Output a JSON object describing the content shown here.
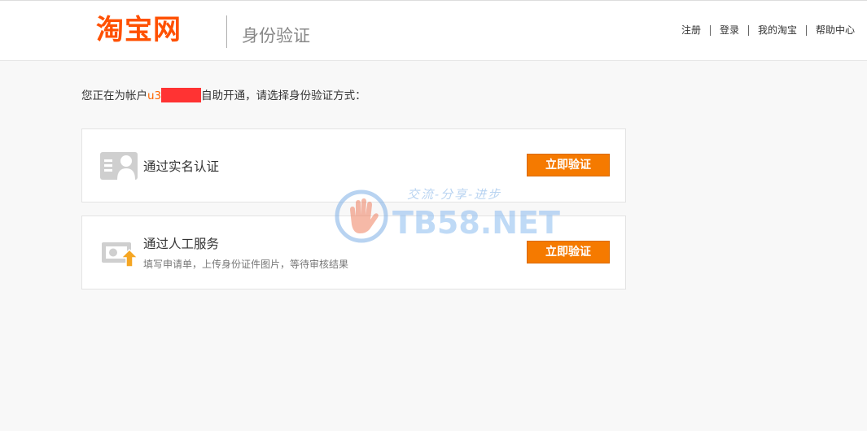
{
  "header": {
    "logo_text": "淘宝网",
    "page_title": "身份验证",
    "nav": [
      {
        "label": "注册"
      },
      {
        "label": "登录"
      },
      {
        "label": "我的淘宝"
      },
      {
        "label": "帮助中心"
      }
    ]
  },
  "main": {
    "prompt_prefix": "您正在为帐户",
    "account_visible": "u3",
    "prompt_suffix": "自助开通，请选择身份验证方式：",
    "options": [
      {
        "title": "通过实名认证",
        "description": "",
        "icon": "id-card-icon",
        "button_label": "立即验证"
      },
      {
        "title": "通过人工服务",
        "description": "填写申请单，上传身份证件图片，等待审核结果",
        "icon": "upload-id-icon",
        "button_label": "立即验证"
      }
    ]
  },
  "watermark": {
    "slogan": "交流-分享-进步",
    "text": "TB58.NET"
  },
  "colors": {
    "brand": "#ff5000",
    "button": "#f57a00",
    "account": "#ff6600",
    "redaction": "#ff3333"
  }
}
